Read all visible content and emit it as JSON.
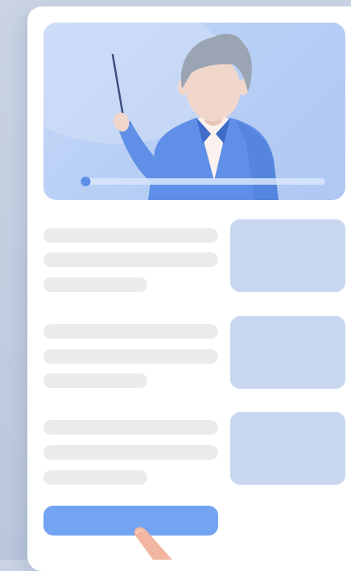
{
  "video": {
    "progress": 0.07,
    "colors": {
      "background": "#b8cff5",
      "suit": "#5f8fe6",
      "hair": "#9aa4b3",
      "skin": "#f1d6cc",
      "progress_track": "#d9e6fb",
      "progress_knob": "#5b8fe9"
    }
  },
  "lessons": [
    {
      "thumbnail_color": "#c8d6ef"
    },
    {
      "thumbnail_color": "#c8d6ef"
    },
    {
      "thumbnail_color": "#c8d6ef"
    }
  ],
  "cta": {
    "label": "",
    "color": "#73a4f2"
  },
  "icons": {
    "pointer": "pointer-stick-icon",
    "hand": "hand-cursor-icon"
  }
}
